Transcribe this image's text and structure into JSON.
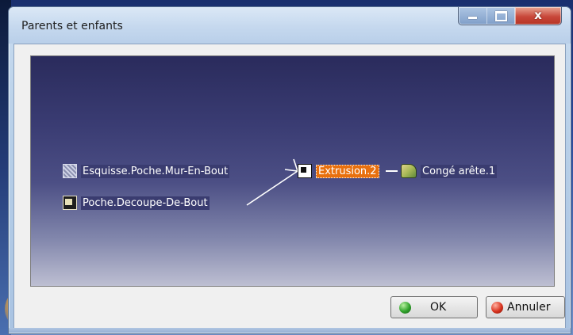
{
  "window": {
    "title": "Parents et enfants",
    "close_glyph": "x"
  },
  "graph": {
    "nodes": [
      {
        "id": "esquisse",
        "label": "Esquisse.Poche.Mur-En-Bout",
        "icon": "sketch-icon"
      },
      {
        "id": "poche",
        "label": "Poche.Decoupe-De-Bout",
        "icon": "pocket-icon"
      },
      {
        "id": "extrusion",
        "label": "Extrusion.2",
        "icon": "extrude-icon",
        "selected": true
      },
      {
        "id": "conge",
        "label": "Congé arête.1",
        "icon": "fillet-icon"
      }
    ]
  },
  "buttons": {
    "ok_label": "OK",
    "cancel_label": "Annuler"
  },
  "colors": {
    "selected_node": "#e8700e",
    "graph_top": "#2a2b5c",
    "graph_bottom": "#bdbfd2",
    "ok_icon": "#2fa22a",
    "cancel_icon": "#d8321e"
  }
}
